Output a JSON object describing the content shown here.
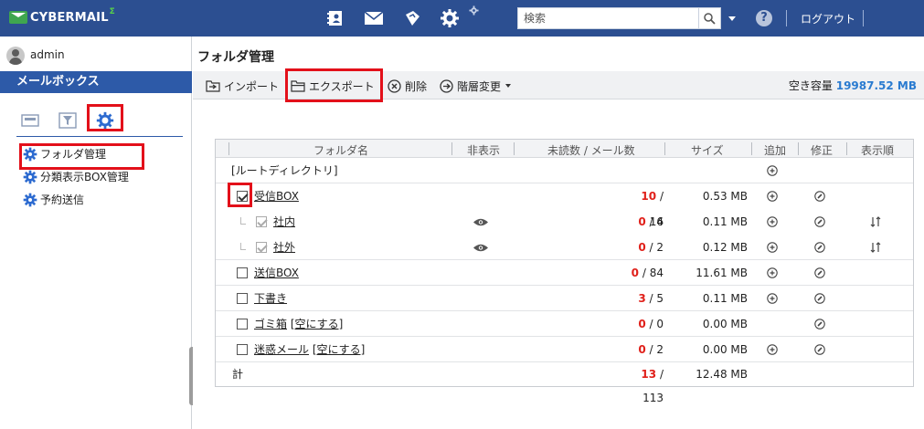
{
  "header": {
    "logo_text": "CYBERMAIL",
    "logo_sup": "Σ",
    "icons": [
      "address-book-icon",
      "mail-icon",
      "shield-icon",
      "settings-icon"
    ],
    "search_placeholder": "検索",
    "help_label": "?",
    "logout_label": "ログアウト"
  },
  "sidebar": {
    "username": "admin",
    "mailbox_title": "メールボックス",
    "tabs": [
      "mailbox-tab",
      "filter-tab",
      "settings-tab"
    ],
    "items": [
      {
        "label": "フォルダ管理"
      },
      {
        "label": "分類表示BOX管理"
      },
      {
        "label": "予約送信"
      }
    ]
  },
  "main": {
    "title": "フォルダ管理",
    "toolbar": {
      "import": "インポート",
      "export": "エクスポート",
      "delete": "削除",
      "hierarchy": "階層変更"
    },
    "capacity_label": "空き容量",
    "capacity_value": "19987.52 MB",
    "table": {
      "headers": [
        "フォルダ名",
        "非表示",
        "未読数 / メール数",
        "サイズ",
        "追加",
        "修正",
        "表示順"
      ],
      "root_label": "[ルートディレクトリ]",
      "rows": [
        {
          "name": "受信BOX",
          "unread": "10",
          "total": "/ 16",
          "size": "0.53 MB",
          "checked": true
        },
        {
          "name": "社内",
          "unread": "0",
          "total": "/ 4",
          "size": "0.11 MB",
          "child": true
        },
        {
          "name": "社外",
          "unread": "0",
          "total": "/ 2",
          "size": "0.12 MB",
          "child": true
        },
        {
          "name": "送信BOX",
          "unread": "0",
          "total": "/ 84",
          "size": "11.61 MB"
        },
        {
          "name": "下書き",
          "unread": "3",
          "total": "/ 5",
          "size": "0.11 MB"
        },
        {
          "name": "ゴミ箱",
          "extra": "[空にする]",
          "unread": "0",
          "total": "/ 0",
          "size": "0.00 MB"
        },
        {
          "name": "迷惑メール",
          "extra": "[空にする]",
          "unread": "0",
          "total": "/ 2",
          "size": "0.00 MB"
        }
      ],
      "total_label": "計",
      "total_unread": "13",
      "total_count": "/ 113",
      "total_size": "12.48 MB"
    }
  },
  "colors": {
    "header_bg": "#2c4f91",
    "sidebar_header_bg": "#2d5aa8",
    "highlight": "#e3101a",
    "unread_red": "#e0201a",
    "capacity_blue": "#2a7bd0"
  }
}
